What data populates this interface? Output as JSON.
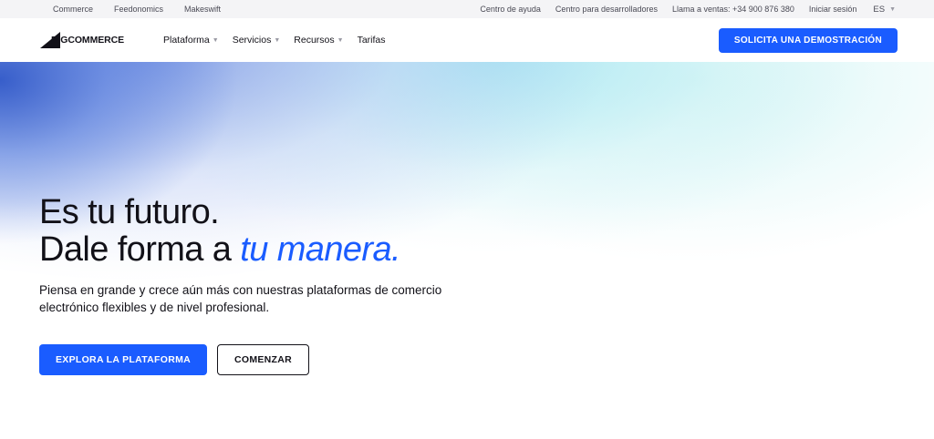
{
  "utility_bar": {
    "left_links": [
      "Commerce",
      "Feedonomics",
      "Makeswift"
    ],
    "right_links": [
      "Centro de ayuda",
      "Centro para desarrolladores",
      "Llama a ventas: +34 900 876 380",
      "Iniciar sesión"
    ],
    "language": "ES"
  },
  "nav": {
    "logo_text": "BIGCOMMERCE",
    "menu": [
      {
        "label": "Plataforma",
        "has_dropdown": true
      },
      {
        "label": "Servicios",
        "has_dropdown": true
      },
      {
        "label": "Recursos",
        "has_dropdown": true
      },
      {
        "label": "Tarifas",
        "has_dropdown": false
      }
    ],
    "cta_label": "SOLICITA UNA DEMOSTRACIÓN"
  },
  "hero": {
    "headline_line1": "Es tu futuro.",
    "headline_line2_plain": "Dale forma a ",
    "headline_line2_accent": "tu manera.",
    "subheadline": "Piensa en grande y crece aún más con nuestras plataformas de comercio electrónico flexibles y de nivel profesional.",
    "primary_cta": "EXPLORA LA PLATAFORMA",
    "secondary_cta": "COMENZAR"
  },
  "colors": {
    "brand_blue": "#1a5cff",
    "text_dark": "#121118",
    "utility_bg": "#f4f4f6"
  }
}
